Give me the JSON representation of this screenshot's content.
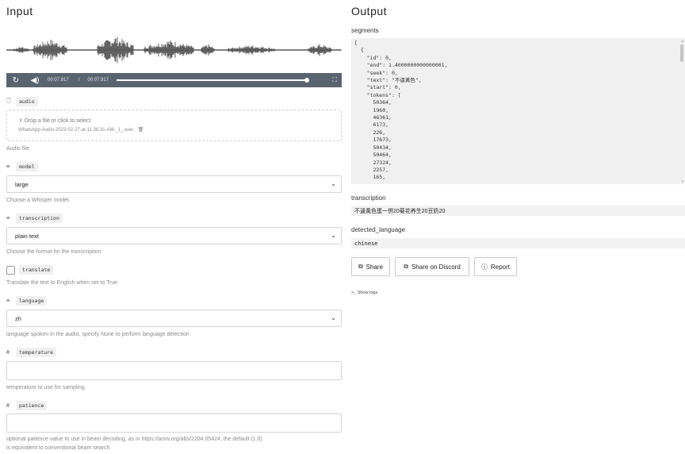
{
  "input": {
    "title": "Input",
    "player": {
      "current_time": "00:07.917",
      "separator": "/",
      "duration": "00:07.917",
      "progress": 1.0
    },
    "audio": {
      "label": "audio",
      "drop_text": "Drop a file or click to select",
      "file_name": "WhatsApp-Audio-2023-02-27-at-11.38.31-AM-_1_.wav",
      "hint": "Audio file"
    },
    "model": {
      "label": "model",
      "value": "large",
      "hint": "Choose a Whisper model."
    },
    "transcription": {
      "label": "transcription",
      "value": "plain text",
      "hint": "Choose the format for the transcription"
    },
    "translate": {
      "label": "translate",
      "checked": false,
      "hint": "Translate the text to English when set to True"
    },
    "language": {
      "label": "language",
      "value": "zh",
      "hint": "language spoken in the audio, specify None to perform language detection"
    },
    "temperature": {
      "label": "temperature",
      "value": "",
      "hint": "temperature to use for sampling"
    },
    "patience": {
      "label": "patience",
      "value": "",
      "hint_line1": "optional patience value to use in beam decoding, as in https://arxiv.org/abs/2204.05424, the default (1.0)",
      "hint_line2": "is equivalent to conventional beam search"
    }
  },
  "output": {
    "title": "Output",
    "segments_label": "segments",
    "segments_json": "[\n  {\n    \"id\": 0,\n    \"end\": 1.4000000000000001,\n    \"seek\": 0,\n    \"text\": \"不逼黃色\",\n    \"start\": 0,\n    \"tokens\": [\n      50364,\n      1960,\n      46361,\n      6173,\n      226,\n      17673,\n      50434,\n      50464,\n      27324,\n      2257,\n      165,",
    "transcription_label": "transcription",
    "transcription_value": "不逼黃色蛋一併20菊花养生20豆奶20",
    "detected_language_label": "detected_language",
    "detected_language_value": "chinese",
    "buttons": {
      "share": "Share",
      "share_discord": "Share on Discord",
      "report": "Report"
    },
    "show_logs": "Show logs"
  },
  "icons": {
    "replay": "replay-icon",
    "volume": "volume-icon",
    "fullscreen": "fullscreen-icon",
    "file": "file-icon",
    "upload": "upload-icon",
    "trash": "trash-icon",
    "list": "list-icon",
    "number": "hash-icon",
    "chevron": "chevron-down-icon",
    "copy": "copy-icon",
    "report": "report-icon",
    "terminal": "terminal-icon"
  }
}
